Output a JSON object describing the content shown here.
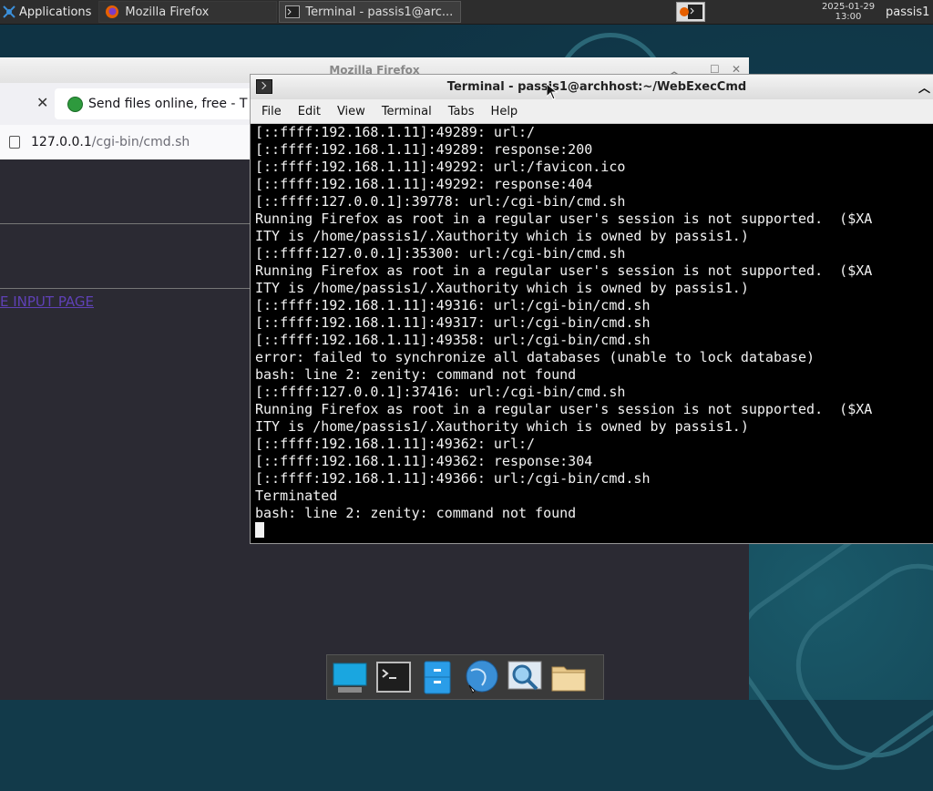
{
  "panel": {
    "apps_menu": "Applications",
    "tasks": [
      {
        "label": "Mozilla Firefox",
        "icon": "firefox-icon"
      },
      {
        "label": "Terminal - passis1@arc...",
        "icon": "terminal-icon"
      }
    ],
    "date": "2025-01-29",
    "time": "13:00",
    "user": "passis1"
  },
  "firefox": {
    "window_title": "Mozilla Firefox",
    "tab_title": "Send files online, free - T",
    "url_host": "127.0.0.1",
    "url_path": "/cgi-bin/cmd.sh",
    "page_link": "E INPUT PAGE"
  },
  "terminal": {
    "window_title": "Terminal - passis1@archhost:~/WebExecCmd",
    "menu": [
      "File",
      "Edit",
      "View",
      "Terminal",
      "Tabs",
      "Help"
    ],
    "lines": [
      "[::ffff:192.168.1.11]:49289: url:/",
      "[::ffff:192.168.1.11]:49289: response:200",
      "[::ffff:192.168.1.11]:49292: url:/favicon.ico",
      "[::ffff:192.168.1.11]:49292: response:404",
      "[::ffff:127.0.0.1]:39778: url:/cgi-bin/cmd.sh",
      "Running Firefox as root in a regular user's session is not supported.  ($XA",
      "ITY is /home/passis1/.Xauthority which is owned by passis1.)",
      "[::ffff:127.0.0.1]:35300: url:/cgi-bin/cmd.sh",
      "Running Firefox as root in a regular user's session is not supported.  ($XA",
      "ITY is /home/passis1/.Xauthority which is owned by passis1.)",
      "[::ffff:192.168.1.11]:49316: url:/cgi-bin/cmd.sh",
      "[::ffff:192.168.1.11]:49317: url:/cgi-bin/cmd.sh",
      "[::ffff:192.168.1.11]:49358: url:/cgi-bin/cmd.sh",
      "error: failed to synchronize all databases (unable to lock database)",
      "bash: line 2: zenity: command not found",
      "[::ffff:127.0.0.1]:37416: url:/cgi-bin/cmd.sh",
      "Running Firefox as root in a regular user's session is not supported.  ($XA",
      "ITY is /home/passis1/.Xauthority which is owned by passis1.)",
      "[::ffff:192.168.1.11]:49362: url:/",
      "[::ffff:192.168.1.11]:49362: response:304",
      "[::ffff:192.168.1.11]:49366: url:/cgi-bin/cmd.sh",
      "Terminated",
      "bash: line 2: zenity: command not found"
    ]
  },
  "dock": {
    "items": [
      "desktop-icon",
      "terminal-icon",
      "file-manager-icon",
      "web-browser-icon",
      "app-finder-icon",
      "folder-icon"
    ]
  }
}
